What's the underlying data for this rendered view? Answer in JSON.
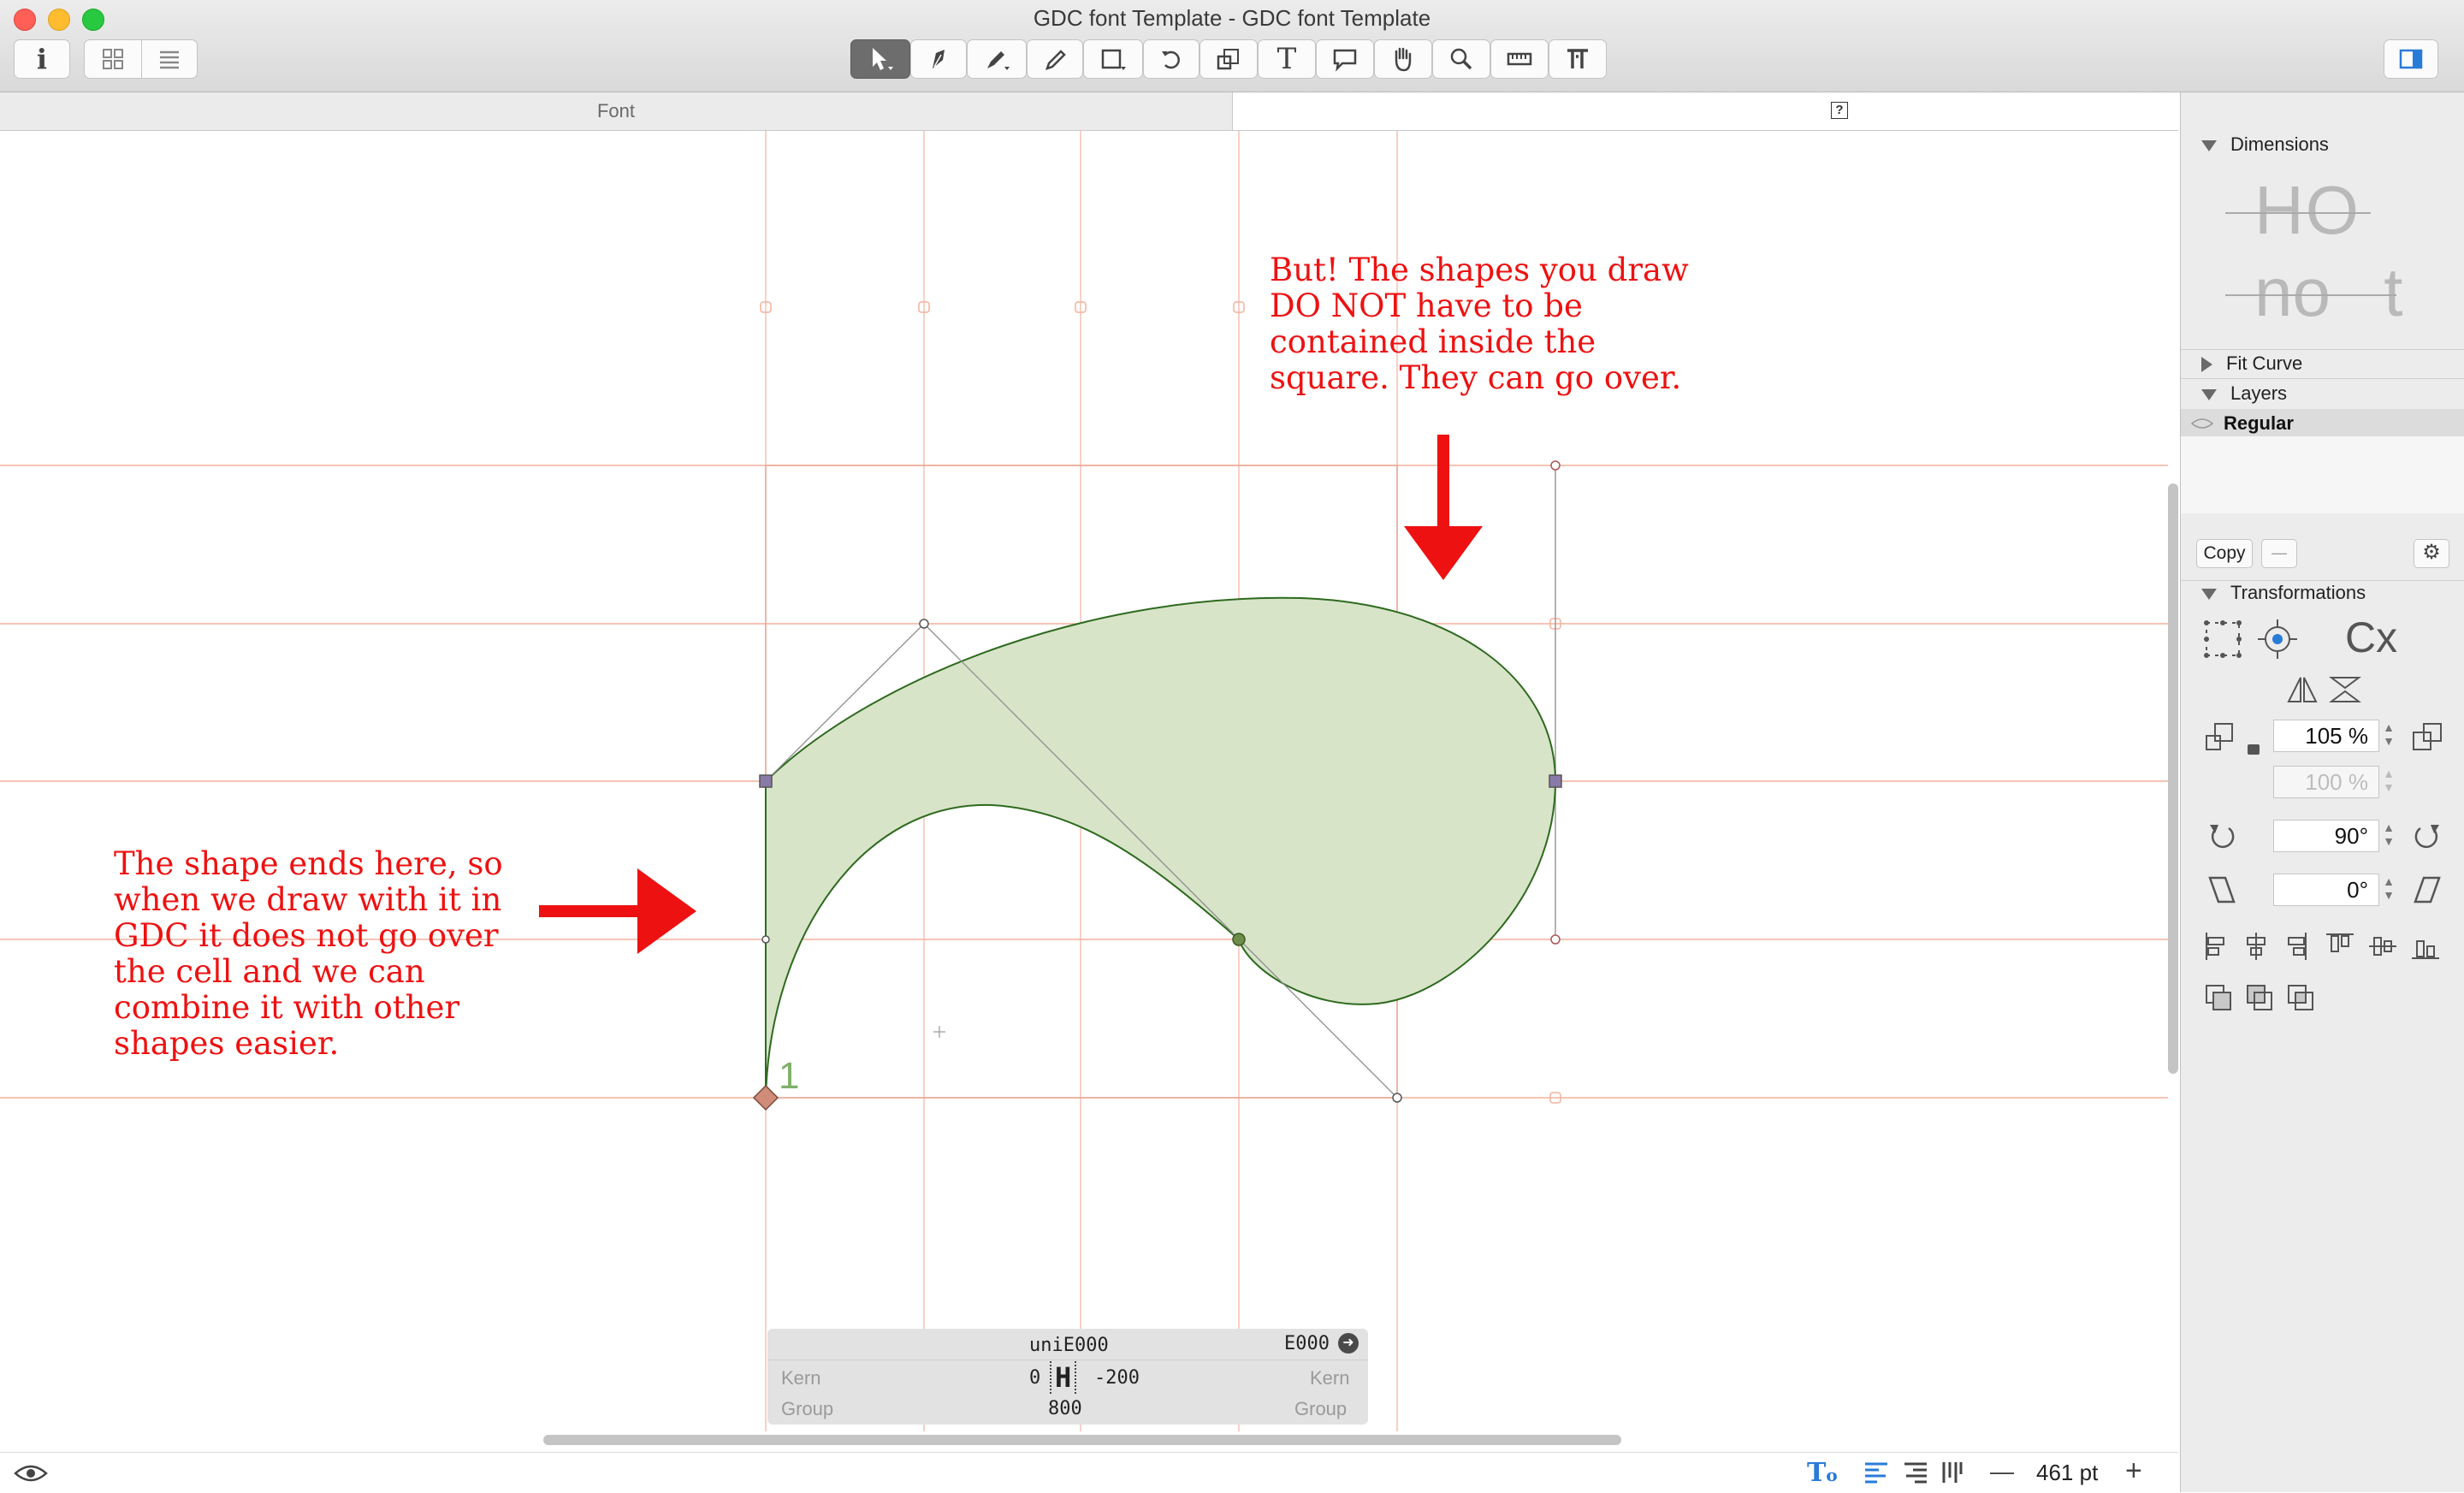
{
  "window": {
    "title": "GDC font Template - GDC font Template",
    "traffic_colors": [
      "#ff5f57",
      "#febc2e",
      "#28c840"
    ]
  },
  "toolbar": {
    "tools": [
      "info-icon",
      "grid-view-icon",
      "list-view-icon",
      "select-tool-icon",
      "draw-tool-icon",
      "pen-tool-icon",
      "pencil-icon",
      "rectangle-tool-icon",
      "rotate-icon",
      "scale-icon",
      "text-tool-icon",
      "annotation-icon",
      "hand-icon",
      "zoom-icon",
      "measure-icon",
      "type-tool-icon",
      "sidebar-toggle-icon"
    ]
  },
  "tabs": {
    "font_tab": "Font",
    "glyph_tab_icon": "?"
  },
  "annotations": {
    "right_note": "But! The shapes you draw\nDO NOT have to be\ncontained inside the\nsquare. They can go over.",
    "left_note": "The shape ends here, so\nwhen we draw with it in\nGDC it does not go over\nthe cell and we can\ncombine it with other\nshapes easier.",
    "color": "#ee1111"
  },
  "canvas": {
    "start_node_label": "1",
    "shape_fill": "#d7e4c8",
    "shape_stroke": "#2e6a1e",
    "guide_color": "#f4b5a3"
  },
  "glyph_info": {
    "glyph_name": "uniE000",
    "unicode": "E000",
    "kern_label_left": "Kern",
    "kern_label_right": "Kern",
    "group_label_left": "Group",
    "group_label_right": "Group",
    "lsb": "0",
    "rsb": "-200",
    "width": "800",
    "glyph_char": "H"
  },
  "bottom_bar": {
    "zoom": "461 pt",
    "zoom_out": "—",
    "zoom_in": "+"
  },
  "panel": {
    "dimensions_label": "Dimensions",
    "dim_preview_1": "HO",
    "dim_preview_2": "no t",
    "fit_curve_label": "Fit Curve",
    "layers_label": "Layers",
    "layer_name": "Regular",
    "copy_button": "Copy",
    "minus_button": "—",
    "transformations_label": "Transformations",
    "scale_value": "105 %",
    "scale_value_2": "100 %",
    "rotate_value": "90°",
    "slant_value": "0°",
    "cx_label": "Cx"
  }
}
